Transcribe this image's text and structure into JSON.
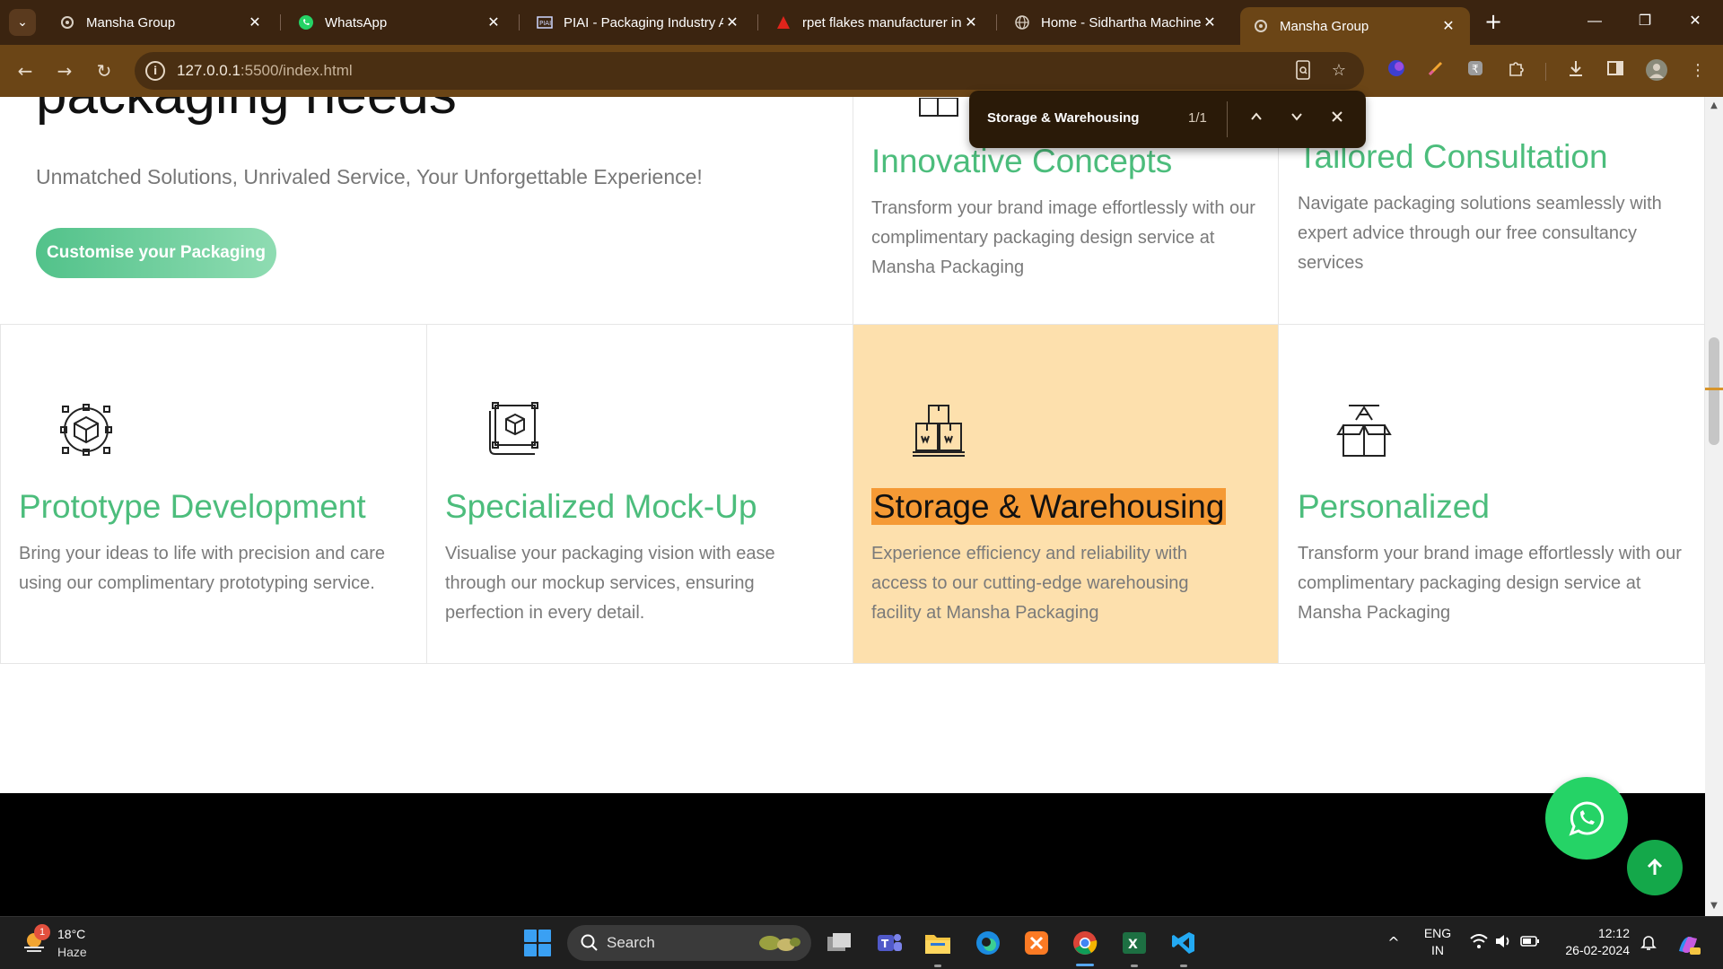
{
  "browser": {
    "tabs": [
      {
        "label": "Mansha Group",
        "favicon": "mansha-logo-icon",
        "active": false
      },
      {
        "label": "WhatsApp",
        "favicon": "whatsapp-icon",
        "active": false
      },
      {
        "label": "PIAI - Packaging Industry A",
        "favicon": "piai-icon",
        "active": false
      },
      {
        "label": "rpet flakes manufacturer in",
        "favicon": "red-triangle-icon",
        "active": false
      },
      {
        "label": "Home - Sidhartha Machine",
        "favicon": "globe-icon",
        "active": false
      },
      {
        "label": "Mansha Group",
        "favicon": "mansha-logo-icon",
        "active": true
      }
    ],
    "url_host": "127.0.0.1",
    "url_path": ":5500/index.html"
  },
  "find_bar": {
    "query": "Storage & Warehousing",
    "count": "1/1"
  },
  "hero": {
    "title": "packaging needs",
    "subtitle": "Unmatched Solutions, Unrivaled Service, Your Unforgettable Experience!",
    "cta_label": "Customise your Packaging"
  },
  "services_top": [
    {
      "title": "Innovative Concepts",
      "text": "Transform your brand image effortlessly with our complimentary packaging design service at Mansha Packaging"
    },
    {
      "title": "Tailored Consultation",
      "text": "Navigate packaging solutions seamlessly with expert advice through our free consultancy services"
    }
  ],
  "services": [
    {
      "title": "Prototype Development",
      "text": "Bring your ideas to life with precision and care using our complimentary prototyping service.",
      "icon": "prototype-icon"
    },
    {
      "title": "Specialized Mock-Up",
      "text": "Visualise your packaging vision with ease through our mockup services, ensuring perfection in every detail.",
      "icon": "mockup-icon"
    },
    {
      "title": "Storage & Warehousing",
      "text": "Experience efficiency and reliability with access to our cutting-edge warehousing facility at Mansha Packaging",
      "icon": "warehouse-icon"
    },
    {
      "title": "Personalized",
      "text": "Transform your brand image effortlessly with our complimentary packaging design service at Mansha Packaging",
      "icon": "personalized-box-icon"
    }
  ],
  "taskbar": {
    "weather_temp": "18°C",
    "weather_cond": "Haze",
    "weather_badge": "1",
    "search_label": "Search",
    "lang_line1": "ENG",
    "lang_line2": "IN",
    "time": "12:12",
    "date": "26-02-2024"
  },
  "colors": {
    "accent_green": "#4cbd7c",
    "highlight_card": "#fde0ad",
    "find_match": "#f59a35",
    "chrome_brown": "#6b4516",
    "whatsapp": "#25d366"
  }
}
